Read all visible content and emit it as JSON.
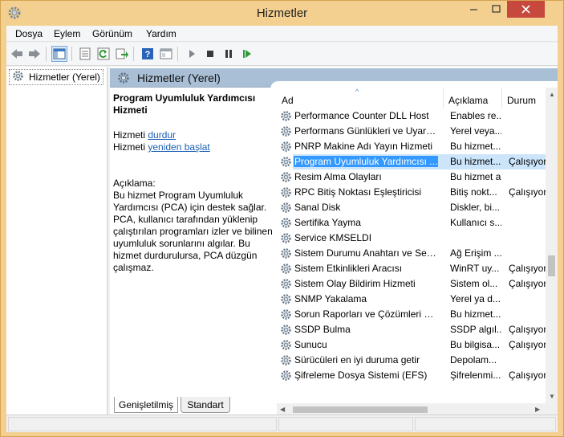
{
  "window": {
    "title": "Hizmetler"
  },
  "menu": [
    "Dosya",
    "Eylem",
    "Görünüm",
    "Yardım"
  ],
  "toolbar": {
    "buttons": [
      "back-icon",
      "forward-icon",
      "show-hide-tree-icon",
      "properties-icon",
      "refresh-icon",
      "export-icon",
      "help-icon",
      "console-icon",
      "play-icon",
      "stop-icon",
      "pause-icon",
      "restart-icon"
    ]
  },
  "tree": {
    "root_label": "Hizmetler (Yerel)"
  },
  "panel": {
    "header_title": "Hizmetler (Yerel)",
    "service_name": "Program Uyumluluk Yardımcısı Hizmeti",
    "action_prefix_1": "Hizmeti",
    "action_link_1": "durdur",
    "action_prefix_2": "Hizmeti",
    "action_link_2": "yeniden başlat",
    "description_label": "Açıklama:",
    "description_text": "Bu hizmet Program Uyumluluk Yardımcısı (PCA) için destek sağlar. PCA, kullanıcı tarafından yüklenip çalıştırılan programları izler ve bilinen uyumluluk sorunlarını algılar. Bu hizmet durdurulursa, PCA düzgün çalışmaz."
  },
  "list": {
    "columns": [
      "Ad",
      "Açıklama",
      "Durum"
    ],
    "rows": [
      {
        "name": "Performance Counter DLL Host",
        "desc": "Enables re...",
        "status": ""
      },
      {
        "name": "Performans Günlükleri ve Uyarıları",
        "desc": "Yerel veya...",
        "status": ""
      },
      {
        "name": "PNRP Makine Adı Yayın Hizmeti",
        "desc": "Bu hizmet...",
        "status": ""
      },
      {
        "name": "Program Uyumluluk Yardımcısı ...",
        "desc": "Bu hizmet...",
        "status": "Çalışıyor",
        "selected": true
      },
      {
        "name": "Resim Alma Olayları",
        "desc": "Bu hizmet al...",
        "status": ""
      },
      {
        "name": "RPC Bitiş Noktası Eşleştiricisi",
        "desc": "Bitiş nokt...",
        "status": "Çalışıyor"
      },
      {
        "name": "Sanal Disk",
        "desc": "Diskler, bi...",
        "status": ""
      },
      {
        "name": "Sertifika Yayma",
        "desc": "Kullanıcı s...",
        "status": ""
      },
      {
        "name": "Service KMSELDI",
        "desc": "",
        "status": ""
      },
      {
        "name": "Sistem Durumu Anahtarı ve Sertif...",
        "desc": "Ağ Erişim ...",
        "status": ""
      },
      {
        "name": "Sistem Etkinlikleri Aracısı",
        "desc": "WinRT uy...",
        "status": "Çalışıyor"
      },
      {
        "name": "Sistem Olay Bildirim Hizmeti",
        "desc": "Sistem ol...",
        "status": "Çalışıyor"
      },
      {
        "name": "SNMP Yakalama",
        "desc": "Yerel ya d...",
        "status": ""
      },
      {
        "name": "Sorun Raporları ve Çözümleri De...",
        "desc": "Bu hizmet...",
        "status": ""
      },
      {
        "name": "SSDP Bulma",
        "desc": "SSDP algıl...",
        "status": "Çalışıyor"
      },
      {
        "name": "Sunucu",
        "desc": "Bu bilgisa...",
        "status": "Çalışıyor"
      },
      {
        "name": "Sürücüleri en iyi duruma getir",
        "desc": "Depolam...",
        "status": ""
      },
      {
        "name": "Şifreleme Dosya Sistemi (EFS)",
        "desc": "Şifrelenmi...",
        "status": "Çalışıyor"
      }
    ]
  },
  "tabs": [
    "Genişletilmiş",
    "Standart"
  ],
  "colors": {
    "titlebar": "#f3d08f",
    "close": "#c7483d",
    "selection": "#3399ff",
    "header": "#a9bfd6"
  }
}
